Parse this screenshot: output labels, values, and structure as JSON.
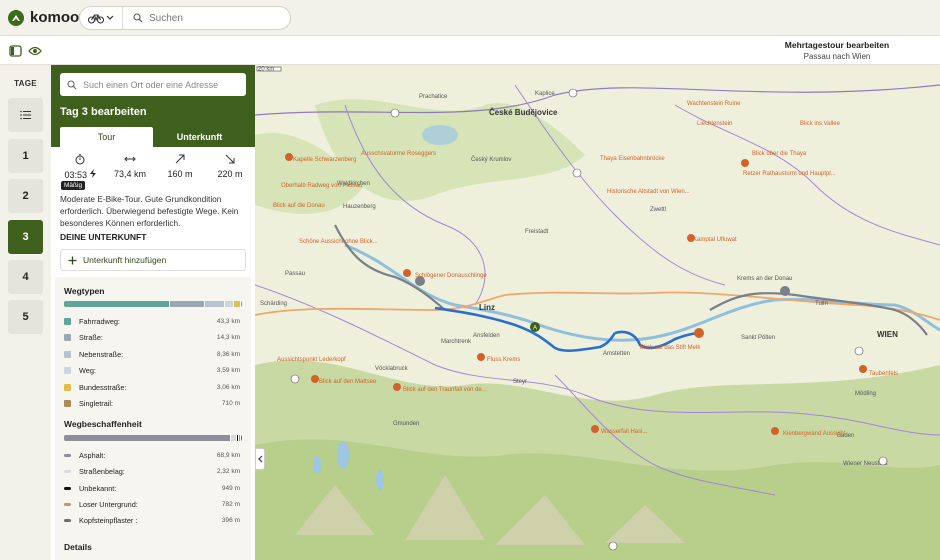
{
  "app": {
    "brand": "komoot",
    "search_placeholder": "Suchen"
  },
  "subbar": {
    "title": "Mehrtagestour bearbeiten",
    "subtitle": "Passau nach Wien"
  },
  "days": {
    "label": "TAGE",
    "items": [
      "1",
      "2",
      "3",
      "4",
      "5"
    ],
    "active": "3"
  },
  "panel": {
    "place_search_placeholder": "Such einen Ort oder eine Adresse",
    "title": "Tag 3 bearbeiten",
    "tabs": [
      "Tour",
      "Unterkunft"
    ],
    "stats": {
      "duration": "03:53",
      "distance": "73,4 km",
      "ascent": "160 m",
      "descent": "220 m"
    },
    "difficulty": "Mäßig",
    "description": "Moderate E-Bike-Tour. Gute Grundkondition erforderlich. Überwiegend befestigte Wege. Kein besonderes Können erforderlich.",
    "accommodation_heading": "DEINE UNTERKUNFT",
    "add_accommodation": "Unterkunft hinzufügen",
    "waytypes": {
      "title": "Wegtypen",
      "items": [
        {
          "name": "Fahrradweg:",
          "value": "43,3 km",
          "km": 43.3,
          "color": "#5fa59a"
        },
        {
          "name": "Straße:",
          "value": "14,3 km",
          "km": 14.3,
          "color": "#9aa8b6"
        },
        {
          "name": "Nebenstraße:",
          "value": "8,36 km",
          "km": 8.36,
          "color": "#b7c3ce"
        },
        {
          "name": "Weg:",
          "value": "3,59 km",
          "km": 3.59,
          "color": "#cdd5dc"
        },
        {
          "name": "Bundesstraße:",
          "value": "3,06 km",
          "km": 3.06,
          "color": "#e1be4c"
        },
        {
          "name": "Singletrail:",
          "value": "710 m",
          "km": 0.71,
          "color": "#a88d58"
        }
      ]
    },
    "surfaces": {
      "title": "Wegbeschaffenheit",
      "items": [
        {
          "name": "Asphalt:",
          "value": "68,9 km",
          "km": 68.9,
          "color": "#8b8f99"
        },
        {
          "name": "Straßenbelag:",
          "value": "2,32 km",
          "km": 2.32,
          "color": "#d9dadd"
        },
        {
          "name": "Unbekannt:",
          "value": "949 m",
          "km": 0.949,
          "color": "#111111"
        },
        {
          "name": "Loser Untergrund:",
          "value": "782 m",
          "km": 0.782,
          "color": "#b39a7c"
        },
        {
          "name": "Kopfsteinpflaster :",
          "value": "396 m",
          "km": 0.396,
          "color": "#6e6e6e"
        }
      ]
    },
    "details": "Details"
  },
  "map": {
    "scale": "20 km",
    "cities": [
      "České Budějovice",
      "Linz",
      "WIEN"
    ],
    "towns": [
      "Prachatice",
      "Český Krumlov",
      "Waldkirchen",
      "Hauzenberg",
      "Passau",
      "Marchtrenk",
      "Ansfelden",
      "Steyr",
      "Vöcklabruck",
      "Gmunden",
      "Krems an der Donau",
      "Sankt Pölten",
      "Amstetten",
      "Zwettl",
      "Schärding",
      "Kaplice",
      "Freistadt",
      "Tulln",
      "Mödling",
      "Baden",
      "Wiener Neustadt"
    ],
    "pois": [
      "Blick über die Thaya",
      "Kamptal Ufluwat",
      "Thaya Eisenbahnbrücke",
      "Retzer Rathausturm und Hauptpl...",
      "Historische Altstadt von Wien...",
      "Blick auf das Stift Melk",
      "Schlögener Donauschlinge",
      "Fluss Krems",
      "Schöne Aussicht ohne Blick...",
      "Blick auf den Mattsee",
      "Blick auf den Traunfall von de...",
      "Kapelle Schwarzenberg",
      "Ausschsvaturme Roseggers",
      "Blick auf die Donau",
      "Oberhalb Radweg von Passau",
      "Aussichtspunkt Lederkopf",
      "Kienbergwand Aussicht",
      "Wasserfall Hasi...",
      "Wachtenstein Ruine",
      "Liechtenstein",
      "Blick ins Vallee",
      "Taubenfels"
    ]
  }
}
